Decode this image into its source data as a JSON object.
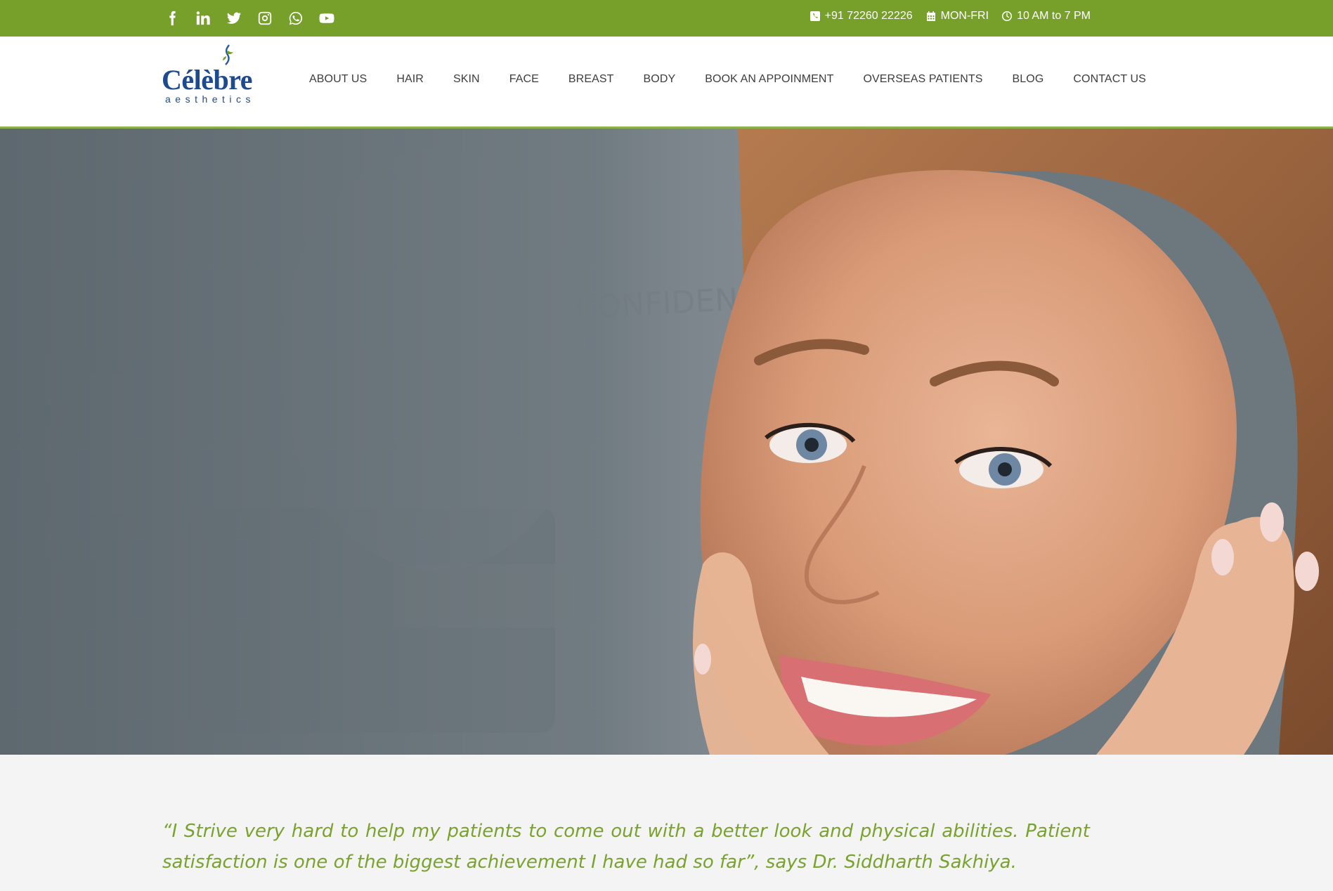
{
  "topbar": {
    "social_icons": [
      "facebook-icon",
      "linkedin-icon",
      "twitter-icon",
      "instagram-icon",
      "whatsapp-icon",
      "youtube-icon"
    ],
    "phone": "+91 72260 22226",
    "days": "MON-FRI",
    "hours": "10 AM to 7 PM",
    "bg_color": "#76a02a"
  },
  "logo": {
    "name": "Célèbre",
    "tagline": "aesthetics"
  },
  "nav": {
    "items": [
      "ABOUT US",
      "HAIR",
      "SKIN",
      "FACE",
      "BREAST",
      "BODY",
      "BOOK AN APPOINMENT",
      "OVERSEAS PATIENTS",
      "BLOG",
      "CONTACT US"
    ]
  },
  "hero": {
    "background_text": "BEAUTY WITH CONFIDENCE"
  },
  "quote": {
    "text": "“I Strive very hard to help my patients to come out with a better look and physical abilities. Patient satisfaction is one of the biggest achievement I have had so far”, says Dr. Siddharth Sakhiya.",
    "color": "#7aa22e"
  }
}
